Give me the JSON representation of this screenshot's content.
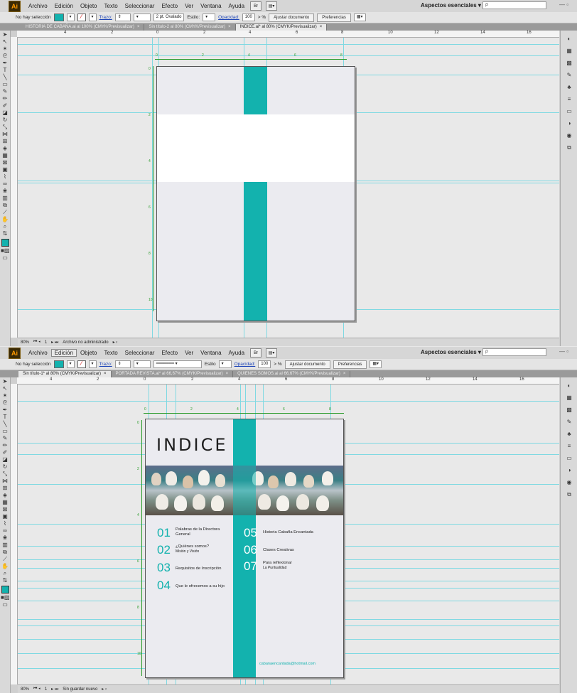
{
  "colors": {
    "accent": "#13b2ae",
    "guide": "#7fd9e2"
  },
  "menu": {
    "logo": "Ai",
    "items": [
      "Archivo",
      "Edición",
      "Objeto",
      "Texto",
      "Seleccionar",
      "Efecto",
      "Ver",
      "Ventana",
      "Ayuda"
    ],
    "workspace": "Aspectos esenciales ▾",
    "search_placeholder": "ρ",
    "window_controls": "— ▫"
  },
  "window1": {
    "control": {
      "selection": "No hay selección",
      "stroke_label": "Trazo:",
      "brush": "2 pt. Ovalado",
      "style_label": "Estilo:",
      "opacity_label": "Opacidad:",
      "opacity": "100",
      "pct": "> %",
      "fit_button": "Ajustar documento",
      "prefs_button": "Preferencias"
    },
    "tabs": [
      {
        "label": "HISTORIA DE CABAÑA.ai al 100% (CMYK/Previsualizar)",
        "active": false
      },
      {
        "label": "Sin título-2 al 80% (CMYK/Previsualizar)",
        "active": false
      },
      {
        "label": "INDICE.ai* al 80% (CMYK/Previsualizar)",
        "active": true
      }
    ],
    "status": {
      "zoom": "80%",
      "page": "1",
      "file_state": "Archivo no administrado"
    }
  },
  "window2": {
    "control": {
      "selection": "No hay selección",
      "stroke_label": "Trazo:",
      "style_label": "Estilo",
      "opacity_label": "Opacidad:",
      "opacity": "100",
      "pct": "> %",
      "fit_button": "Ajustar documento",
      "prefs_button": "Preferencias"
    },
    "tabs": [
      {
        "label": "Sin título-1* al 80% (CMYK/Previsualizar)",
        "active": true
      },
      {
        "label": "PORTADA REVISTA.ai* al 66,67% (CMYK/Previsualizar)",
        "active": false
      },
      {
        "label": "QUIENES SOMOS.ai al 66,67% (CMYK/Previsualizar)",
        "active": false
      }
    ],
    "status": {
      "zoom": "80%",
      "page": "1",
      "file_state": "Sin guardar nuevo"
    }
  },
  "document": {
    "title": "INDICE",
    "entries": [
      {
        "num": "01",
        "text": "Palabras de la Directora",
        "sub": "General"
      },
      {
        "num": "02",
        "text": "¿Quiénes somos?",
        "sub": "Misión y Visión"
      },
      {
        "num": "03",
        "text": "Requisitos de Inscripción",
        "sub": ""
      },
      {
        "num": "04",
        "text": "Que le ofrecemos a su hijo",
        "sub": ""
      },
      {
        "num": "05",
        "text": "Historia Cabaña Encantada",
        "sub": ""
      },
      {
        "num": "06",
        "text": "Clases Creativas",
        "sub": ""
      },
      {
        "num": "07",
        "text": "Para reflexionar",
        "sub": "La Puntualidad"
      }
    ],
    "email": "cabanaencantada@hotmail.com"
  },
  "ruler": {
    "h_numbers": [
      "4",
      "2",
      "0",
      "2",
      "4",
      "6",
      "8",
      "10",
      "12",
      "14",
      "16"
    ],
    "art_numbers": [
      "0",
      "2",
      "4",
      "6",
      "8"
    ]
  }
}
